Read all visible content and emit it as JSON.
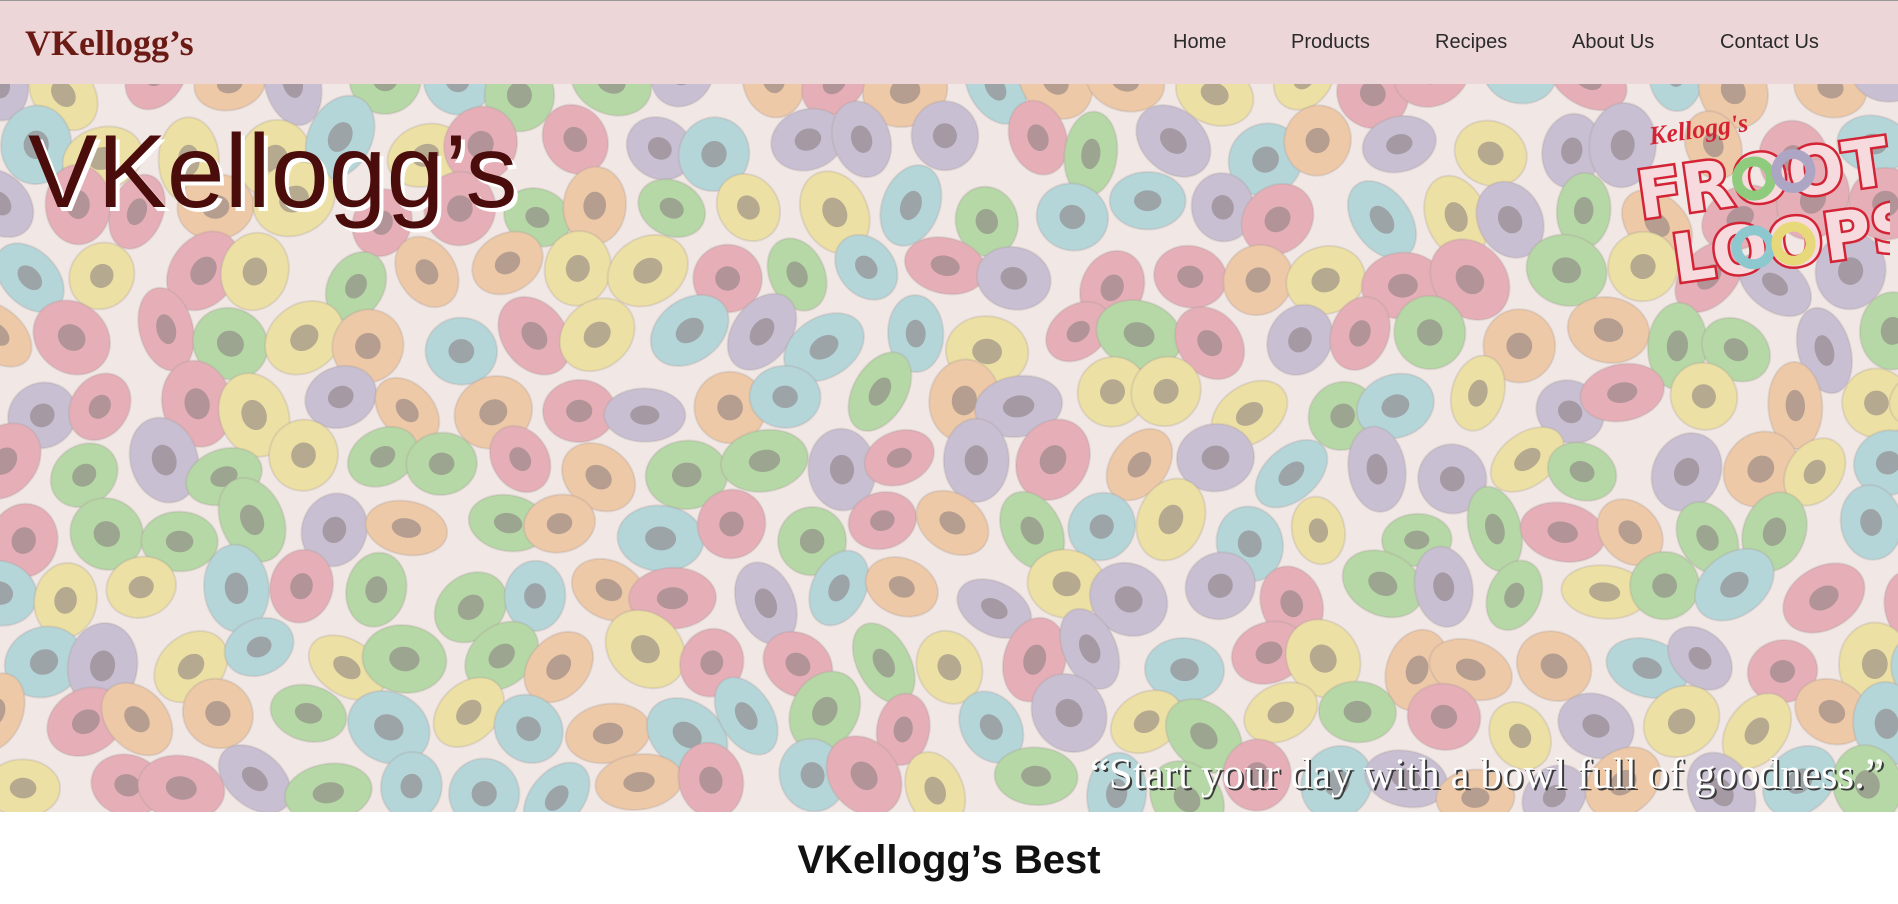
{
  "nav": {
    "brand": "VKellogg’s",
    "links": [
      "Home",
      "Products",
      "Recipes",
      "About Us",
      "Contact Us"
    ]
  },
  "hero": {
    "title": "VKellogg’s",
    "logo": {
      "brand_script": "Kellogg's",
      "line1": "FROOT",
      "line2": "LOOPS"
    },
    "quote": "“Start your day with a bowl full of goodness.”",
    "background_icon": "froot-loops-cereal-pattern"
  },
  "section": {
    "title": "VKellogg’s Best"
  },
  "colors": {
    "navbar_bg": "#ecd6d8",
    "brand": "#6b1a14",
    "hero_title": "#4b0d0b",
    "logo_red": "#d32335",
    "loop_colors": [
      "#de8a98",
      "#8fcb7c",
      "#8ec8cf",
      "#ada5c4",
      "#e7d979",
      "#e9b37e"
    ]
  }
}
